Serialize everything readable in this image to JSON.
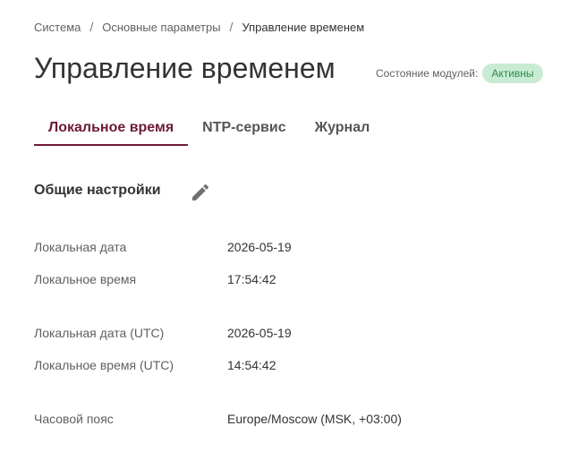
{
  "breadcrumb": {
    "items": [
      "Система",
      "Основные параметры",
      "Управление временем"
    ],
    "separator": "/"
  },
  "page_title": "Управление временем",
  "module_state": {
    "label": "Состояние модулей:",
    "value": "Активны"
  },
  "tabs": [
    {
      "label": "Локальное время",
      "active": true
    },
    {
      "label": "NTP-сервис",
      "active": false
    },
    {
      "label": "Журнал",
      "active": false
    }
  ],
  "section": {
    "title": "Общие настройки",
    "edit_icon": "pencil-icon"
  },
  "fields": [
    {
      "label": "Локальная дата",
      "value": "2026-05-19"
    },
    {
      "label": "Локальное время",
      "value": "17:54:42"
    },
    {
      "label": "Локальная дата (UTC)",
      "value": "2026-05-19"
    },
    {
      "label": "Локальное время (UTC)",
      "value": "14:54:42"
    },
    {
      "label": "Часовой пояс",
      "value": "Europe/Moscow (MSK, +03:00)"
    }
  ],
  "colors": {
    "accent": "#6d1a36",
    "badge_bg": "#c8ecd3",
    "badge_text": "#2e8b4e"
  }
}
